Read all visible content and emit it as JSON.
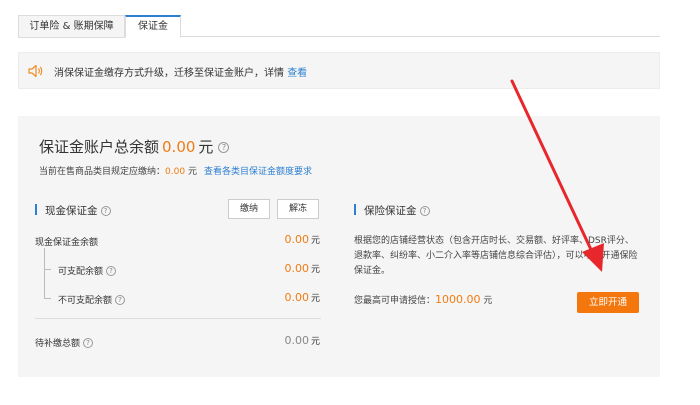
{
  "tabs": [
    {
      "label": "订单险 & 账期保障"
    },
    {
      "label": "保证金"
    }
  ],
  "notice": {
    "text": "消保保证金缴存方式升级，迁移至保证金账户，详情 ",
    "link": "查看"
  },
  "account": {
    "title": "保证金账户总余额",
    "amount": "0.00",
    "unit": "元",
    "required_text": "当前在售商品类目规定应缴纳：",
    "required_amount": "0.00",
    "required_unit": "元",
    "required_link": "查看各类目保证金额度要求"
  },
  "cash": {
    "title": "现金保证金",
    "pay_button": "缴纳",
    "release_button": "解冻",
    "rows": [
      {
        "label": "现金保证金余额",
        "value": "0.00",
        "unit": "元"
      },
      {
        "label": "可支配余额",
        "value": "0.00",
        "unit": "元"
      },
      {
        "label": "不可支配余额",
        "value": "0.00",
        "unit": "元"
      }
    ],
    "pending": {
      "label": "待补缴总额",
      "value": "0.00",
      "unit": "元"
    }
  },
  "insurance": {
    "title": "保险保证金",
    "description": "根据您的店铺经营状态（包含开店时长、交易额、好评率、DSR评分、退款率、纠纷率、小二介入率等店铺信息综合评估），可以申请开通保险保证金。",
    "credit_label": "您最高可申请授信：",
    "credit_amount": "1000.00",
    "credit_unit": "元",
    "open_button": "立即开通"
  },
  "colors": {
    "accent": "#2d7fd1",
    "orange": "#f4770e",
    "arrow": "#e8272c"
  }
}
